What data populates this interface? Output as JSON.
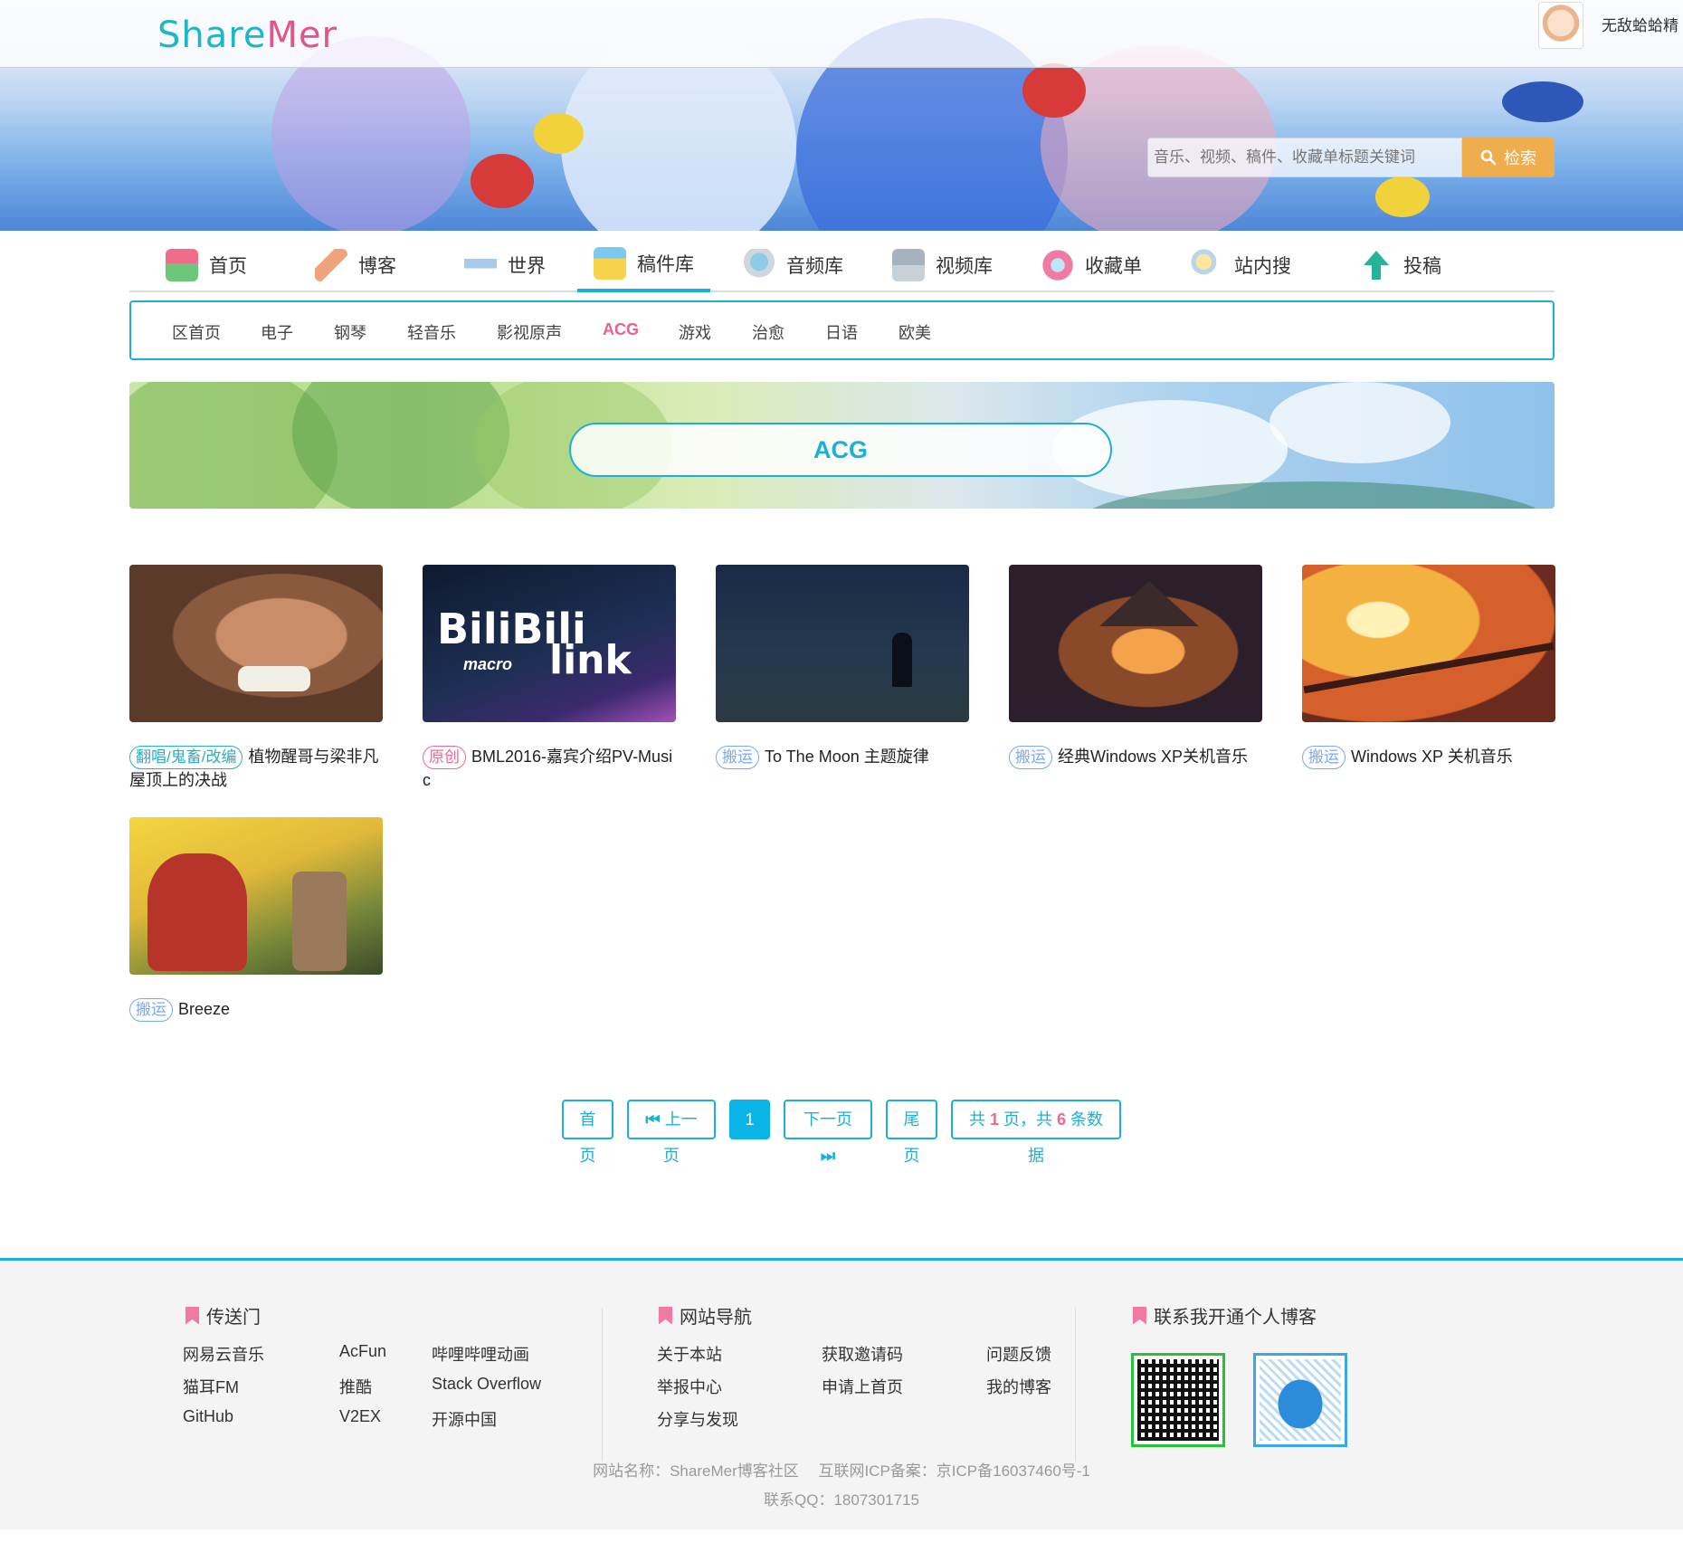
{
  "header": {
    "logo_share": "Share",
    "logo_mer": "Mer",
    "user_name": "无敌蛤蛤精",
    "search": {
      "placeholder": "音乐、视频、稿件、收藏单标题关键词",
      "button_label": "检索",
      "button_color": "#f0ad4e"
    }
  },
  "main_nav": [
    {
      "label": "首页",
      "icon": "home-icon"
    },
    {
      "label": "博客",
      "icon": "feather-icon"
    },
    {
      "label": "世界",
      "icon": "airplane-icon"
    },
    {
      "label": "稿件库",
      "icon": "upload-box-icon",
      "active": true
    },
    {
      "label": "音频库",
      "icon": "microphone-icon"
    },
    {
      "label": "视频库",
      "icon": "camera-icon"
    },
    {
      "label": "收藏单",
      "icon": "heart-icon"
    },
    {
      "label": "站内搜",
      "icon": "magnifier-icon"
    },
    {
      "label": "投稿",
      "icon": "up-arrow-icon"
    }
  ],
  "sub_nav": [
    "区首页",
    "电子",
    "钢琴",
    "轻音乐",
    "影视原声",
    "ACG",
    "游戏",
    "治愈",
    "日语",
    "欧美"
  ],
  "sub_nav_active": "ACG",
  "section_title": "ACG",
  "cards": [
    {
      "tag": "翻唱/鬼畜/改编",
      "tag_style": "teal",
      "title": "植物醒哥与梁非凡屋顶上的决战"
    },
    {
      "tag": "原创",
      "tag_style": "pink",
      "title": "BML2016-嘉宾介绍PV-Music",
      "thumb_text_1": "BiliBili",
      "thumb_text_2": "macro",
      "thumb_text_3": "link"
    },
    {
      "tag": "搬运",
      "tag_style": "blue",
      "title": "To The Moon 主题旋律"
    },
    {
      "tag": "搬运",
      "tag_style": "blue",
      "title": "经典Windows XP关机音乐"
    },
    {
      "tag": "搬运",
      "tag_style": "blue",
      "title": "Windows XP 关机音乐"
    },
    {
      "tag": "搬运",
      "tag_style": "blue",
      "title": "Breeze"
    }
  ],
  "pagination": {
    "first": "首页",
    "prev": "上一页",
    "current": "1",
    "next": "下一页",
    "last": "尾页",
    "summary_prefix": "共",
    "total_pages": "1",
    "summary_mid": "页，共",
    "total_items": "6",
    "summary_suffix": "条数据"
  },
  "footer": {
    "col1_title": "传送门",
    "col1_links": [
      "网易云音乐",
      "AcFun",
      "哔哩哔哩动画",
      "猫耳FM",
      "推酷",
      "Stack Overflow",
      "GitHub",
      "V2EX",
      "开源中国"
    ],
    "col2_title": "网站导航",
    "col2_links": [
      "关于本站",
      "获取邀请码",
      "问题反馈",
      "举报中心",
      "申请上首页",
      "我的博客",
      "分享与发现"
    ],
    "col3_title": "联系我开通个人博客",
    "site_info": "网站名称：ShareMer博客社区　 互联网ICP备案：京ICP备16037460号-1",
    "contact": "联系QQ：1807301715"
  },
  "colors": {
    "accent": "#1cb0d6",
    "pink": "#ef5e8e",
    "orange": "#f0ad4e"
  }
}
